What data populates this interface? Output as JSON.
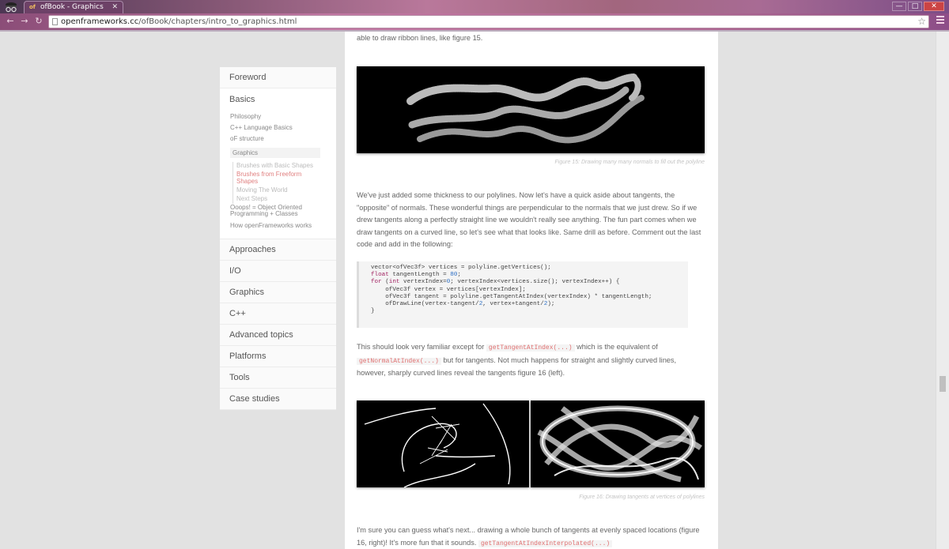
{
  "browser": {
    "tab_title": "ofBook - Graphics",
    "tab_favicon": "of",
    "url_domain": "openframeworks.cc",
    "url_path": "/ofBook/chapters/intro_to_graphics.html"
  },
  "sidebar": {
    "foreword": "Foreword",
    "basics": {
      "title": "Basics",
      "items": [
        "Philosophy",
        "C++ Language Basics",
        "oF structure"
      ],
      "graphics": "Graphics",
      "graphics_items": [
        "Brushes with Basic Shapes",
        "Brushes from Freeform Shapes",
        "Moving The World",
        "Next Steps"
      ],
      "more_items": [
        "Ooops! = Object Oriented Programming + Classes",
        "How openFrameworks works"
      ]
    },
    "sections": [
      "Approaches",
      "I/O",
      "Graphics",
      "C++",
      "Advanced topics",
      "Platforms",
      "Tools",
      "Case studies"
    ]
  },
  "content": {
    "top_line": "able to draw ribbon lines, like figure 15.",
    "fig15_caption": "Figure 15: Drawing many many normals to fill out the polyline",
    "para1": "We've just added some thickness to our polylines. Now let's have a quick aside about tangents, the \"opposite\" of normals. These wonderful things are perpendicular to the normals that we just drew. So if we drew tangents along a perfectly straight line we wouldn't really see anything. The fun part comes when we draw tangents on a curved line, so let's see what that looks like. Same drill as before. Comment out the last code and add in the following:",
    "code": {
      "l1": "vector<ofVec3f> vertices = polyline.getVertices();",
      "l2_kw": "float",
      "l2_rest": " tangentLength = ",
      "l2_num": "80",
      "l3_kw": "for",
      "l3_a": " (",
      "l3_kw2": "int",
      "l3_b": " vertexIndex=",
      "l3_num": "0",
      "l3_c": "; vertexIndex<vertices.size(); vertexIndex++) {",
      "l4": "    ofVec3f vertex = vertices[vertexIndex];",
      "l5": "    ofVec3f tangent = polyline.getTangentAtIndex(vertexIndex) * tangentLength;",
      "l6_a": "    ofDrawLine(vertex-tangent/",
      "l6_n1": "2",
      "l6_b": ", vertex+tangent/",
      "l6_n2": "2",
      "l6_c": ");",
      "l7": "}"
    },
    "para2_a": "This should look very familiar except for ",
    "para2_code1": "getTangentAtIndex(...)",
    "para2_b": " which is the equivalent of ",
    "para2_code2": "getNormalAtIndex(...)",
    "para2_c": " but for tangents. Not much happens for straight and slightly curved lines, however, sharply curved lines reveal the tangents figure 16 (left).",
    "fig16_caption": "Figure 16: Drawing tangents at vertices of polylines",
    "para3_a": "I'm sure you can guess what's next... drawing a whole bunch of tangents at evenly spaced locations (figure 16, right)! It's more fun that it sounds. ",
    "para3_code": "getTangentAtIndexInterpolated(...)"
  },
  "window_controls": [
    "—",
    "□",
    "✕"
  ]
}
